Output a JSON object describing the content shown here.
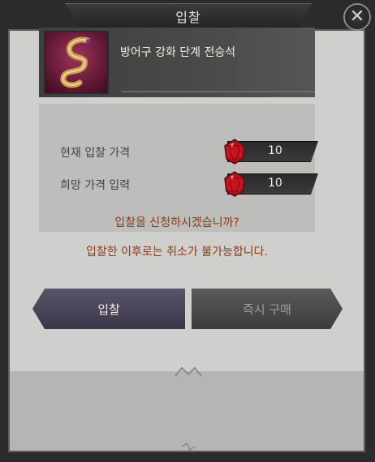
{
  "dialog": {
    "title": "입찰",
    "close_symbol": "✕"
  },
  "item": {
    "name": "방어구 강화 단계 전승석",
    "icon": "coiled-scroll-icon"
  },
  "rows": [
    {
      "label": "현재 입찰 가격",
      "value": "10",
      "currency_icon": "red-gem-icon"
    },
    {
      "label": "희망 가격 입력",
      "value": "10",
      "currency_icon": "red-gem-icon"
    }
  ],
  "messages": {
    "confirm": "입찰을 신청하시겠습니까?",
    "warning": "입찰한 이후로는 취소가 불가능합니다."
  },
  "buttons": {
    "bid": "입찰",
    "instant_buy": "즉시 구매"
  },
  "colors": {
    "panel_bg": "#cfcfcd",
    "message_text": "#8c3a12",
    "bid_button": "#4a455a",
    "disabled_button": "#4a4a4a"
  }
}
